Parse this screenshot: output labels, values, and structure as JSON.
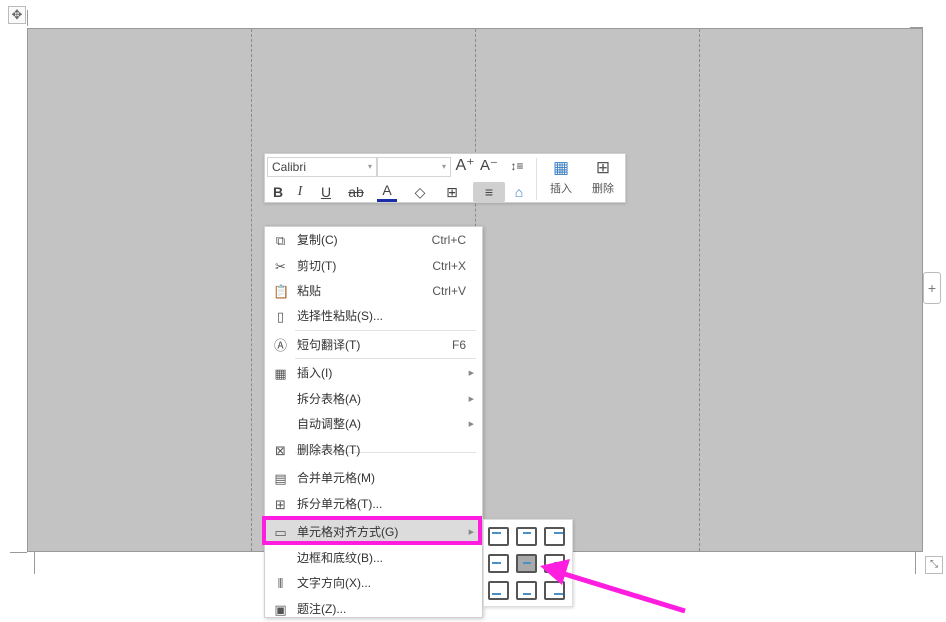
{
  "toolbar": {
    "font_name": "Calibri",
    "font_size": "",
    "grow_font": "A⁺",
    "shrink_font": "A⁻",
    "line_spacing": "↕≡",
    "bold": "B",
    "italic": "I",
    "underline": "U",
    "strike": "ab",
    "font_color": "A",
    "shading": "◇",
    "borders": "⊞",
    "align": "≡",
    "eraser": "⌂",
    "insert_label": "插入",
    "delete_label": "删除",
    "font_color_value": "#1a2ea8"
  },
  "menu": {
    "items": [
      {
        "label": "复制(C)",
        "shortcut": "Ctrl+C",
        "icon": "copy-icon"
      },
      {
        "label": "剪切(T)",
        "shortcut": "Ctrl+X",
        "icon": "cut-icon"
      },
      {
        "label": "粘贴",
        "shortcut": "Ctrl+V",
        "icon": "paste-icon"
      },
      {
        "label": "选择性粘贴(S)...",
        "shortcut": "",
        "icon": "paste-special-icon"
      },
      {
        "label": "短句翻译(T)",
        "shortcut": "F6",
        "icon": "translate-icon"
      },
      {
        "label": "插入(I)",
        "shortcut": "",
        "icon": "table-insert-icon",
        "submenu": true
      },
      {
        "label": "拆分表格(A)",
        "shortcut": "",
        "icon": "",
        "submenu": true
      },
      {
        "label": "自动调整(A)",
        "shortcut": "",
        "icon": "",
        "submenu": true
      },
      {
        "label": "删除表格(T)",
        "shortcut": "",
        "icon": "table-delete-icon"
      },
      {
        "label": "合并单元格(M)",
        "shortcut": "",
        "icon": "merge-cells-icon"
      },
      {
        "label": "拆分单元格(T)...",
        "shortcut": "",
        "icon": "split-cells-icon"
      },
      {
        "label": "单元格对齐方式(G)",
        "shortcut": "",
        "icon": "cell-align-icon",
        "submenu": true,
        "highlighted": true
      },
      {
        "label": "边框和底纹(B)...",
        "shortcut": "",
        "icon": ""
      },
      {
        "label": "文字方向(X)...",
        "shortcut": "",
        "icon": "text-direction-icon"
      },
      {
        "label": "题注(Z)...",
        "shortcut": "",
        "icon": "caption-icon"
      }
    ]
  },
  "submenu": {
    "options": [
      "top-left",
      "top-center",
      "top-right",
      "middle-left",
      "middle-center",
      "middle-right",
      "bottom-left",
      "bottom-center",
      "bottom-right"
    ],
    "selected": "middle-center"
  },
  "colors": {
    "highlight": "#ff1ee0",
    "table_bg": "#c3c3c3"
  }
}
